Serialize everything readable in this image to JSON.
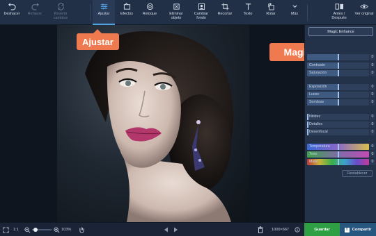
{
  "toolbar": {
    "undo": "Deshacer",
    "redo": "Rehacer",
    "revert": "Revertir cambios",
    "adjust": "Ajustar",
    "effects": "Efectos",
    "retouch": "Retoque",
    "remove_object": "Eliminar objeto",
    "change_background": "Cambiar fondo",
    "crop": "Recortar",
    "text": "Texto",
    "rotate": "Rotar",
    "more": "Más",
    "before_after": "Antes / Después",
    "original": "Ver original"
  },
  "callouts": {
    "adjust": "Ajustar",
    "magic_enhance": "Magic Enhance"
  },
  "panel": {
    "magic_enhance": "Magic Enhance",
    "sliders": [
      {
        "name": "",
        "value": "0",
        "level": 0.5
      },
      {
        "name": "Contraste",
        "value": "0",
        "level": 0.5
      },
      {
        "name": "Saturación",
        "value": "0",
        "level": 0.5
      },
      {
        "name": "Exposición",
        "value": "0",
        "level": 0.5
      },
      {
        "name": "Luces",
        "value": "0",
        "level": 0.5
      },
      {
        "name": "Sombras",
        "value": "0",
        "level": 0.5
      },
      {
        "name": "Nitidez",
        "value": "0",
        "level": 0.0
      },
      {
        "name": "Detalles",
        "value": "0",
        "level": 0.0
      },
      {
        "name": "Desenfocar",
        "value": "0",
        "level": 0.0
      },
      {
        "name": "Temperatura",
        "value": "0",
        "level": 0.5
      },
      {
        "name": "Tono",
        "value": "0",
        "level": 0.5
      },
      {
        "name": "Matiz",
        "value": "0",
        "level": 0.5
      }
    ],
    "reset": "Restablecer"
  },
  "status": {
    "fit": "1:1",
    "zoom": "103%",
    "size": "1000×667",
    "save": "Guardar",
    "share": "Compartir"
  },
  "colors": {
    "accent": "#4fa3e0",
    "callout": "#f07a4f",
    "save": "#2ea043",
    "share": "#27577f"
  }
}
